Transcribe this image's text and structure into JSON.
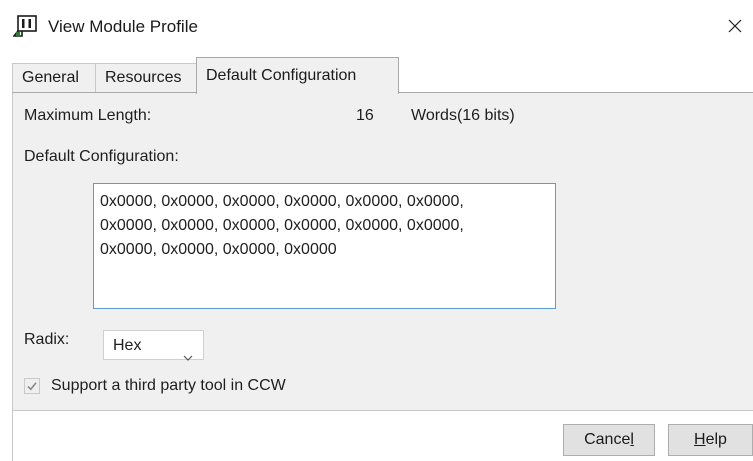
{
  "window": {
    "title": "View Module Profile"
  },
  "tabs": [
    {
      "label": "General"
    },
    {
      "label": "Resources"
    },
    {
      "label": "Default Configuration"
    }
  ],
  "fields": {
    "max_length_label": "Maximum Length:",
    "max_length_value": "16",
    "max_length_unit": "Words(16 bits)",
    "default_config_label": "Default Configuration:",
    "default_config_value": "0x0000, 0x0000, 0x0000, 0x0000, 0x0000, 0x0000,\n0x0000, 0x0000, 0x0000, 0x0000, 0x0000, 0x0000,\n0x0000, 0x0000, 0x0000, 0x0000",
    "radix_label": "Radix:",
    "radix_value": "Hex",
    "support_checkbox_label": "Support a third party tool in CCW",
    "support_checked": true
  },
  "buttons": {
    "cancel_prefix": "Cance",
    "cancel_mnemonic": "l",
    "help_prefix": "",
    "help_mnemonic": "H",
    "help_suffix": "elp"
  },
  "icons": [
    "module-profile-icon",
    "close-icon",
    "chevron-down-icon",
    "checkmark-icon"
  ],
  "colors": {
    "panel_bg": "#f0f0f0",
    "focus_border": "#5b9bd5",
    "button_bg": "#e1e1e1"
  }
}
